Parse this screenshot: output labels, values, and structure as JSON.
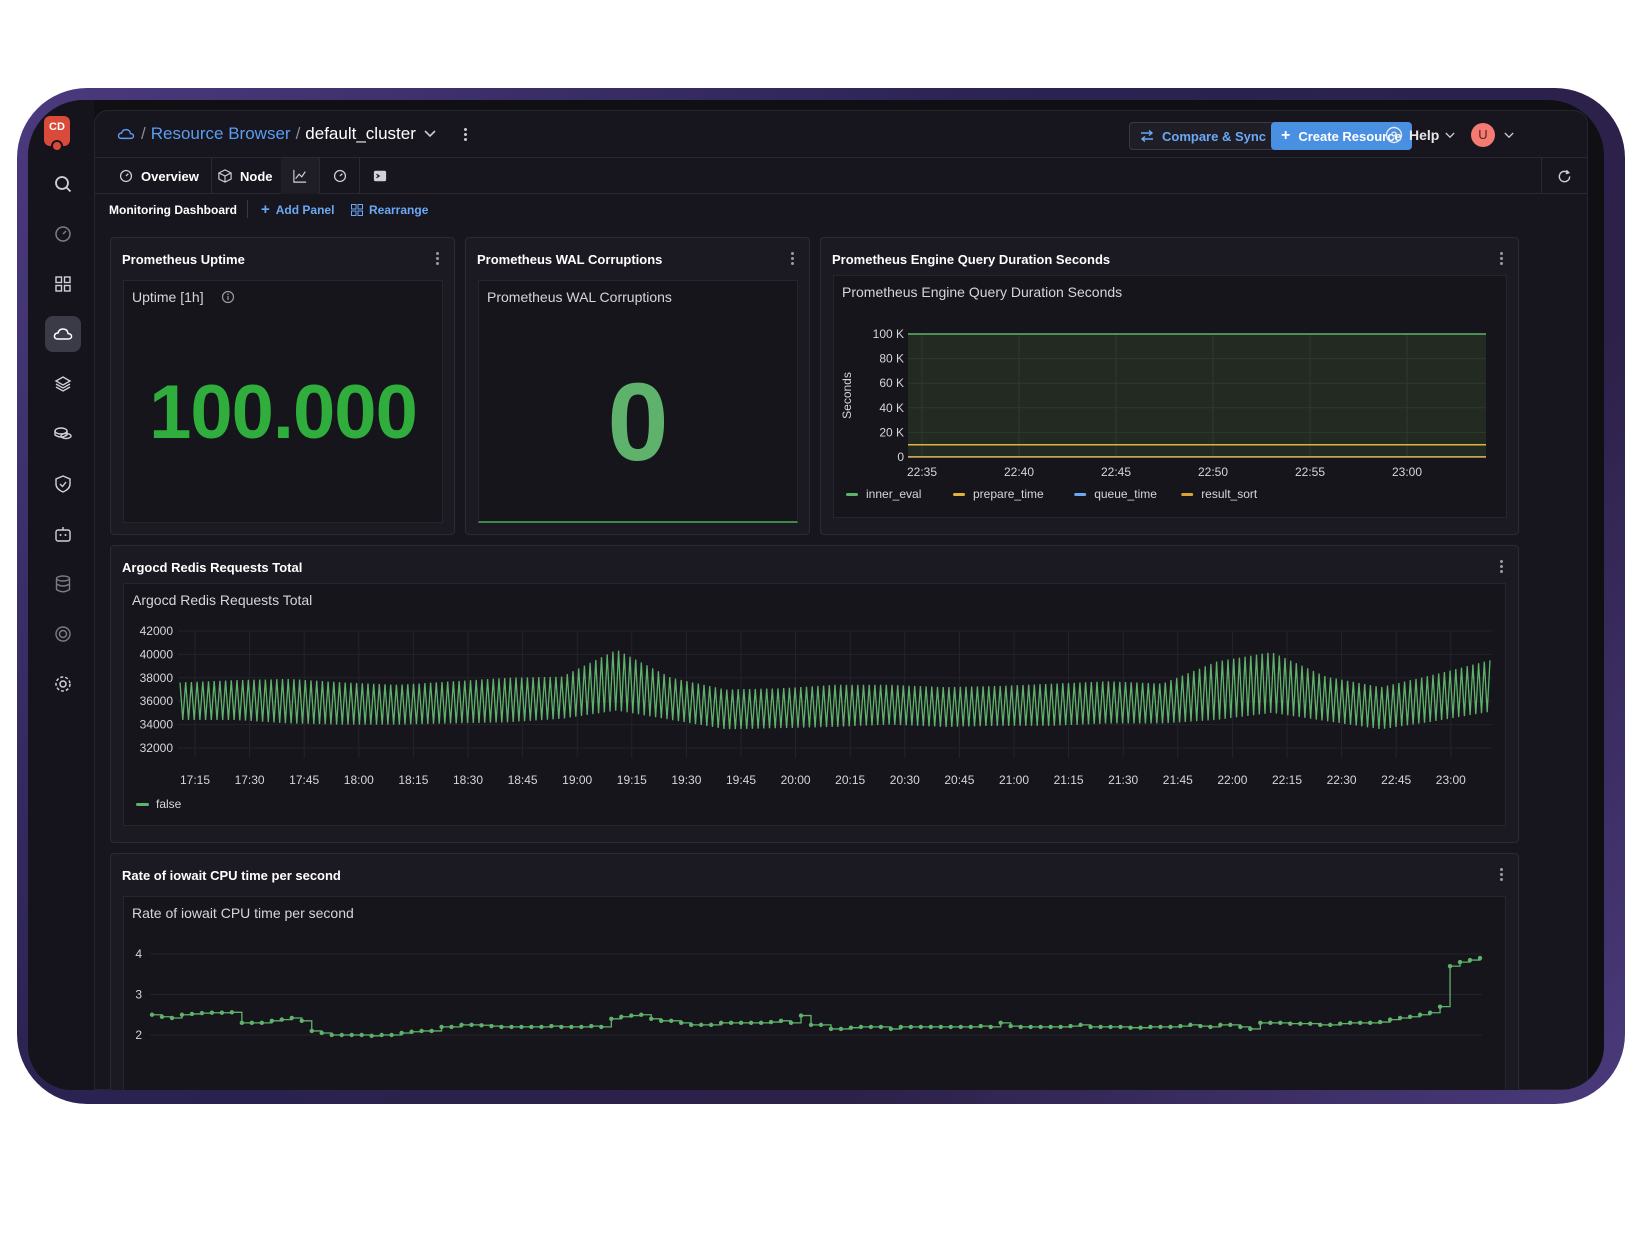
{
  "breadcrumb": {
    "sep": "/",
    "root": "Resource Browser",
    "sep2": "/",
    "cluster": "default_cluster"
  },
  "header": {
    "compare_label": "Compare & Sync",
    "create_label": "Create Resource",
    "help_label": "Help",
    "avatar_letter": "U"
  },
  "tabs": [
    {
      "label": "Overview"
    },
    {
      "label": "Node"
    }
  ],
  "subbar": {
    "title": "Monitoring Dashboard",
    "add_panel": "Add Panel",
    "rearrange": "Rearrange"
  },
  "panels": {
    "uptime": {
      "title": "Prometheus Uptime",
      "inner_title": "Uptime [1h]",
      "value": "100.000",
      "color": "#2fae3d"
    },
    "wal": {
      "title": "Prometheus WAL Corruptions",
      "inner_title": "Prometheus WAL Corruptions",
      "value": "0",
      "color": "#5fb26b"
    },
    "engine": {
      "title": "Prometheus Engine Query Duration Seconds",
      "inner_title": "Prometheus Engine Query Duration Seconds"
    },
    "redis": {
      "title": "Argocd Redis Requests Total",
      "inner_title": "Argocd Redis Requests Total"
    },
    "iowait": {
      "title": "Rate of iowait CPU time per second",
      "inner_title": "Rate of iowait CPU time per second"
    }
  },
  "chart_data": [
    {
      "id": "engine",
      "type": "line",
      "ylabel": "Seconds",
      "y_ticks": [
        "0",
        "20 K",
        "40 K",
        "60 K",
        "80 K",
        "100 K"
      ],
      "ylim": [
        0,
        100000
      ],
      "x_ticks": [
        "22:35",
        "22:40",
        "22:45",
        "22:50",
        "22:55",
        "23:00"
      ],
      "series": [
        {
          "name": "inner_eval",
          "color": "#5fb26b",
          "values": [
            100000,
            100000
          ]
        },
        {
          "name": "prepare_time",
          "color": "#e2b33c",
          "values": [
            10000,
            10000
          ]
        },
        {
          "name": "queue_time",
          "color": "#6aa8f5",
          "values": [
            200,
            200
          ]
        },
        {
          "name": "result_sort",
          "color": "#d9a23a",
          "values": [
            0,
            0
          ]
        }
      ],
      "legend": "bottom"
    },
    {
      "id": "redis",
      "type": "line",
      "y_ticks": [
        "32000",
        "34000",
        "36000",
        "38000",
        "40000",
        "42000"
      ],
      "ylim": [
        31000,
        42500
      ],
      "x_ticks": [
        "17:15",
        "17:30",
        "17:45",
        "18:00",
        "18:15",
        "18:30",
        "18:45",
        "19:00",
        "19:15",
        "19:30",
        "19:45",
        "20:00",
        "20:15",
        "20:30",
        "20:45",
        "21:00",
        "21:15",
        "21:30",
        "21:45",
        "22:00",
        "22:15",
        "22:30",
        "22:45",
        "23:00"
      ],
      "series": [
        {
          "name": "false",
          "color": "#5fb26b"
        }
      ],
      "envelope": {
        "center": [
          36000,
          36100,
          36000,
          35800,
          35700,
          35900,
          36100,
          36300,
          37800,
          36200,
          35300,
          35400,
          35600,
          35700,
          35500,
          35600,
          35700,
          35900,
          35800,
          36900,
          37600,
          36200,
          35400,
          36300,
          37300
        ],
        "amplitude": [
          1600,
          1700,
          1900,
          1800,
          1700,
          1800,
          1900,
          1800,
          2600,
          1800,
          1700,
          1700,
          1800,
          1700,
          1700,
          1700,
          1800,
          1800,
          1700,
          2500,
          2600,
          1900,
          1800,
          2000,
          2200
        ]
      },
      "legend": "bottom-left"
    },
    {
      "id": "iowait",
      "type": "line",
      "y_ticks": [
        "2",
        "3",
        "4"
      ],
      "ylim": [
        2,
        4
      ],
      "series": [
        {
          "color": "#5fb26b",
          "values": [
            2.5,
            2.45,
            2.42,
            2.5,
            2.52,
            2.54,
            2.55,
            2.55,
            2.56,
            2.3,
            2.3,
            2.3,
            2.35,
            2.38,
            2.42,
            2.35,
            2.1,
            2.05,
            2.0,
            2.0,
            2.0,
            2.0,
            1.98,
            2.0,
            2.0,
            2.05,
            2.08,
            2.1,
            2.1,
            2.2,
            2.2,
            2.25,
            2.25,
            2.24,
            2.22,
            2.2,
            2.2,
            2.2,
            2.2,
            2.2,
            2.22,
            2.2,
            2.2,
            2.2,
            2.22,
            2.2,
            2.4,
            2.45,
            2.48,
            2.5,
            2.4,
            2.35,
            2.35,
            2.3,
            2.25,
            2.25,
            2.25,
            2.3,
            2.3,
            2.3,
            2.3,
            2.3,
            2.32,
            2.35,
            2.3,
            2.48,
            2.25,
            2.25,
            2.15,
            2.15,
            2.18,
            2.2,
            2.2,
            2.2,
            2.15,
            2.2,
            2.2,
            2.2,
            2.2,
            2.2,
            2.2,
            2.2,
            2.2,
            2.22,
            2.2,
            2.3,
            2.22,
            2.2,
            2.2,
            2.2,
            2.2,
            2.2,
            2.22,
            2.25,
            2.2,
            2.2,
            2.2,
            2.2,
            2.18,
            2.18,
            2.2,
            2.2,
            2.2,
            2.22,
            2.25,
            2.22,
            2.2,
            2.25,
            2.25,
            2.2,
            2.15,
            2.3,
            2.3,
            2.3,
            2.28,
            2.28,
            2.28,
            2.25,
            2.25,
            2.28,
            2.3,
            2.3,
            2.3,
            2.32,
            2.38,
            2.42,
            2.45,
            2.5,
            2.55,
            2.7,
            3.7,
            3.8,
            3.85,
            3.9
          ]
        }
      ]
    }
  ]
}
